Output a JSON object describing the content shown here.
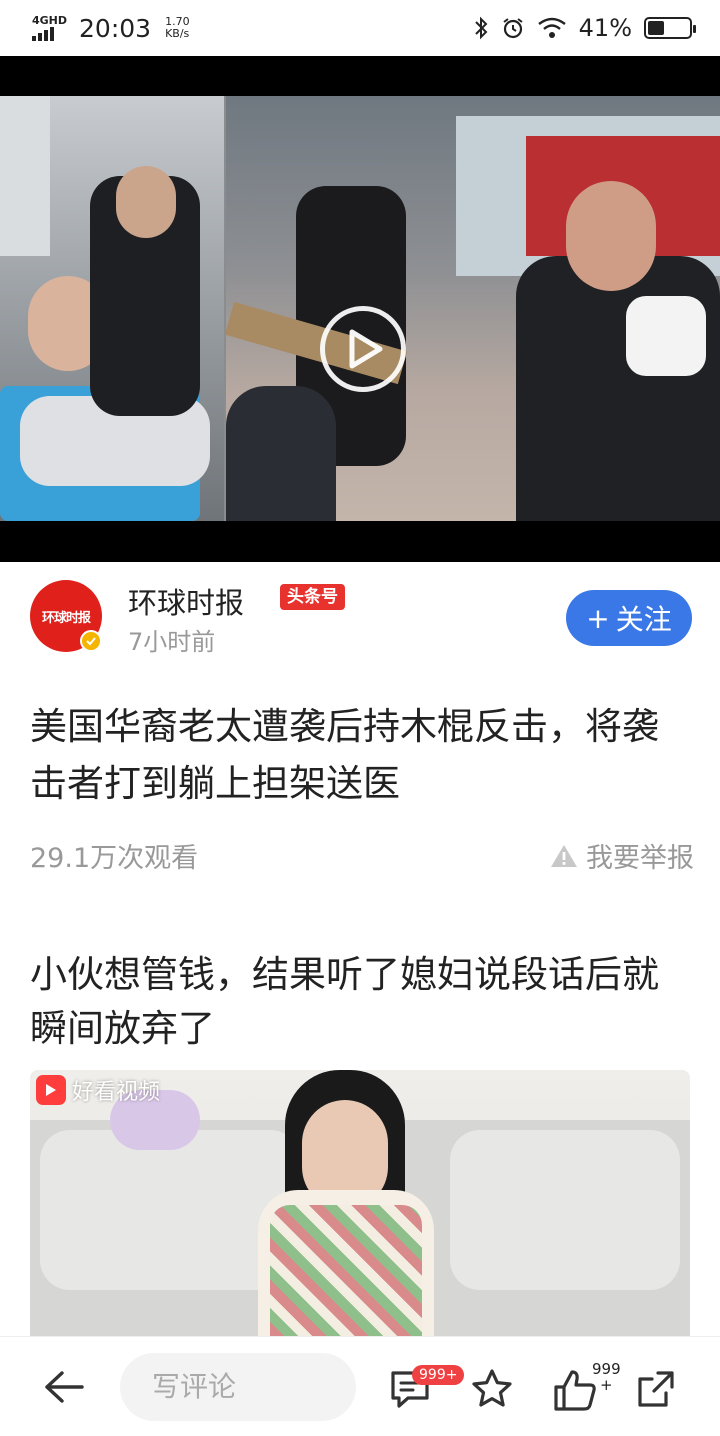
{
  "status_bar": {
    "network": "4GHD",
    "time": "20:03",
    "speed_value": "1.70",
    "speed_unit": "KB/s",
    "battery_text": "41%",
    "battery_level": 0.41
  },
  "video": {
    "icons": [
      "play-icon"
    ]
  },
  "author": {
    "name": "环球时报",
    "avatar_text": "环球时报",
    "badge": "头条号",
    "time": "7小时前",
    "follow_label": "关注",
    "follow_plus": "+"
  },
  "article": {
    "title": "美国华裔老太遭袭后持木棍反击，将袭击者打到躺上担架送医",
    "views": "29.1万次观看",
    "report_label": "我要举报"
  },
  "next_article": {
    "title": "小伙想管钱，结果听了媳妇说段话后就瞬间放弃了",
    "watermark": "好看视频"
  },
  "bottom_bar": {
    "comment_placeholder": "写评论",
    "comment_count": "999+",
    "like_count_top": "999",
    "like_count_bottom": "+"
  },
  "colors": {
    "accent": "#3b78e7",
    "badge_red": "#e8322d",
    "count_red": "#f04142"
  }
}
